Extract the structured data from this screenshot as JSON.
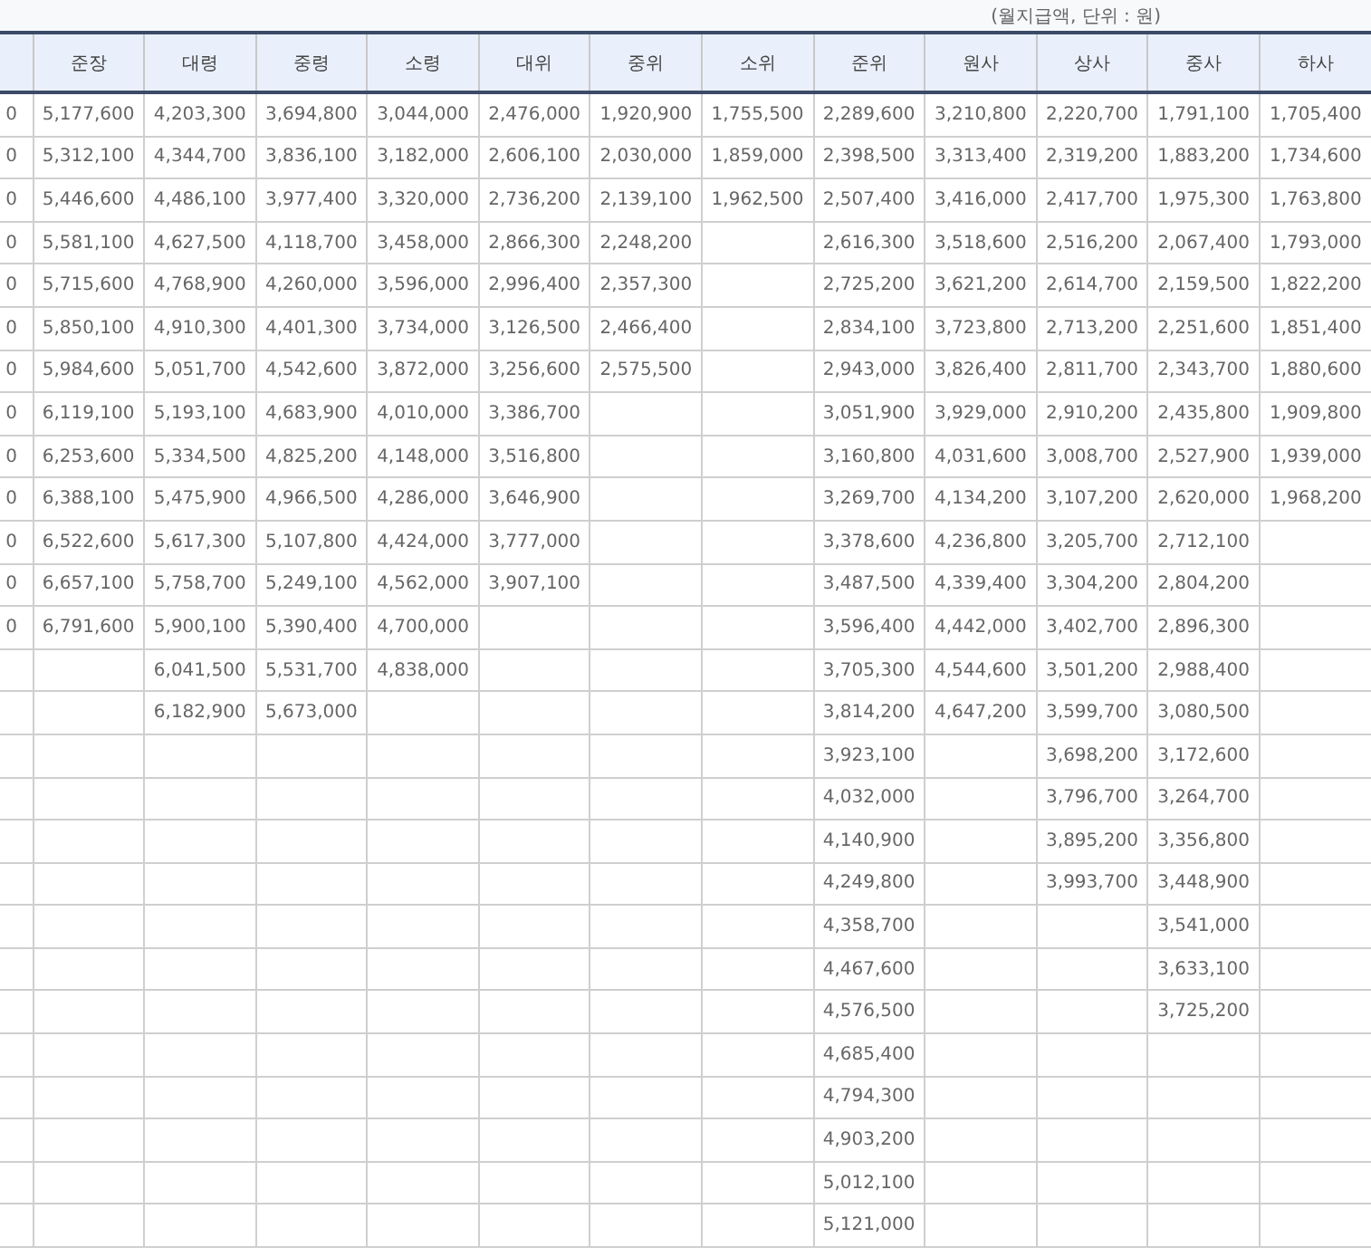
{
  "caption": "(월지급액, 단위 : 원)",
  "table": {
    "columns": [
      {
        "values": [
          "0",
          "0",
          "0",
          "0",
          "0",
          "0",
          "0",
          "0",
          "0",
          "0",
          "0",
          "0",
          "0"
        ]
      },
      {
        "header": "준장",
        "values": [
          "5,177,600",
          "5,312,100",
          "5,446,600",
          "5,581,100",
          "5,715,600",
          "5,850,100",
          "5,984,600",
          "6,119,100",
          "6,253,600",
          "6,388,100",
          "6,522,600",
          "6,657,100",
          "6,791,600"
        ]
      },
      {
        "header": "대령",
        "values": [
          "4,203,300",
          "4,344,700",
          "4,486,100",
          "4,627,500",
          "4,768,900",
          "4,910,300",
          "5,051,700",
          "5,193,100",
          "5,334,500",
          "5,475,900",
          "5,617,300",
          "5,758,700",
          "5,900,100",
          "6,041,500",
          "6,182,900"
        ]
      },
      {
        "header": "중령",
        "values": [
          "3,694,800",
          "3,836,100",
          "3,977,400",
          "4,118,700",
          "4,260,000",
          "4,401,300",
          "4,542,600",
          "4,683,900",
          "4,825,200",
          "4,966,500",
          "5,107,800",
          "5,249,100",
          "5,390,400",
          "5,531,700",
          "5,673,000"
        ]
      },
      {
        "header": "소령",
        "values": [
          "3,044,000",
          "3,182,000",
          "3,320,000",
          "3,458,000",
          "3,596,000",
          "3,734,000",
          "3,872,000",
          "4,010,000",
          "4,148,000",
          "4,286,000",
          "4,424,000",
          "4,562,000",
          "4,700,000",
          "4,838,000"
        ]
      },
      {
        "header": "대위",
        "values": [
          "2,476,000",
          "2,606,100",
          "2,736,200",
          "2,866,300",
          "2,996,400",
          "3,126,500",
          "3,256,600",
          "3,386,700",
          "3,516,800",
          "3,646,900",
          "3,777,000",
          "3,907,100"
        ]
      },
      {
        "header": "중위",
        "values": [
          "1,920,900",
          "2,030,000",
          "2,139,100",
          "2,248,200",
          "2,357,300",
          "2,466,400",
          "2,575,500"
        ]
      },
      {
        "header": "소위",
        "values": [
          "1,755,500",
          "1,859,000",
          "1,962,500"
        ]
      },
      {
        "header": "준위",
        "values": [
          "2,289,600",
          "2,398,500",
          "2,507,400",
          "2,616,300",
          "2,725,200",
          "2,834,100",
          "2,943,000",
          "3,051,900",
          "3,160,800",
          "3,269,700",
          "3,378,600",
          "3,487,500",
          "3,596,400",
          "3,705,300",
          "3,814,200",
          "3,923,100",
          "4,032,000",
          "4,140,900",
          "4,249,800",
          "4,358,700",
          "4,467,600",
          "4,576,500",
          "4,685,400",
          "4,794,300",
          "4,903,200",
          "5,012,100",
          "5,121,000"
        ]
      },
      {
        "header": "원사",
        "values": [
          "3,210,800",
          "3,313,400",
          "3,416,000",
          "3,518,600",
          "3,621,200",
          "3,723,800",
          "3,826,400",
          "3,929,000",
          "4,031,600",
          "4,134,200",
          "4,236,800",
          "4,339,400",
          "4,442,000",
          "4,544,600",
          "4,647,200"
        ]
      },
      {
        "header": "상사",
        "values": [
          "2,220,700",
          "2,319,200",
          "2,417,700",
          "2,516,200",
          "2,614,700",
          "2,713,200",
          "2,811,700",
          "2,910,200",
          "3,008,700",
          "3,107,200",
          "3,205,700",
          "3,304,200",
          "3,402,700",
          "3,501,200",
          "3,599,700",
          "3,698,200",
          "3,796,700",
          "3,895,200",
          "3,993,700"
        ]
      },
      {
        "header": "중사",
        "values": [
          "1,791,100",
          "1,883,200",
          "1,975,300",
          "2,067,400",
          "2,159,500",
          "2,251,600",
          "2,343,700",
          "2,435,800",
          "2,527,900",
          "2,620,000",
          "2,712,100",
          "2,804,200",
          "2,896,300",
          "2,988,400",
          "3,080,500",
          "3,172,600",
          "3,264,700",
          "3,356,800",
          "3,448,900",
          "3,541,000",
          "3,633,100",
          "3,725,200"
        ]
      },
      {
        "header": "하사",
        "values": [
          "1,705,400",
          "1,734,600",
          "1,763,800",
          "1,793,000",
          "1,822,200",
          "1,851,400",
          "1,880,600",
          "1,909,800",
          "1,939,000",
          "1,968,200"
        ]
      }
    ]
  }
}
